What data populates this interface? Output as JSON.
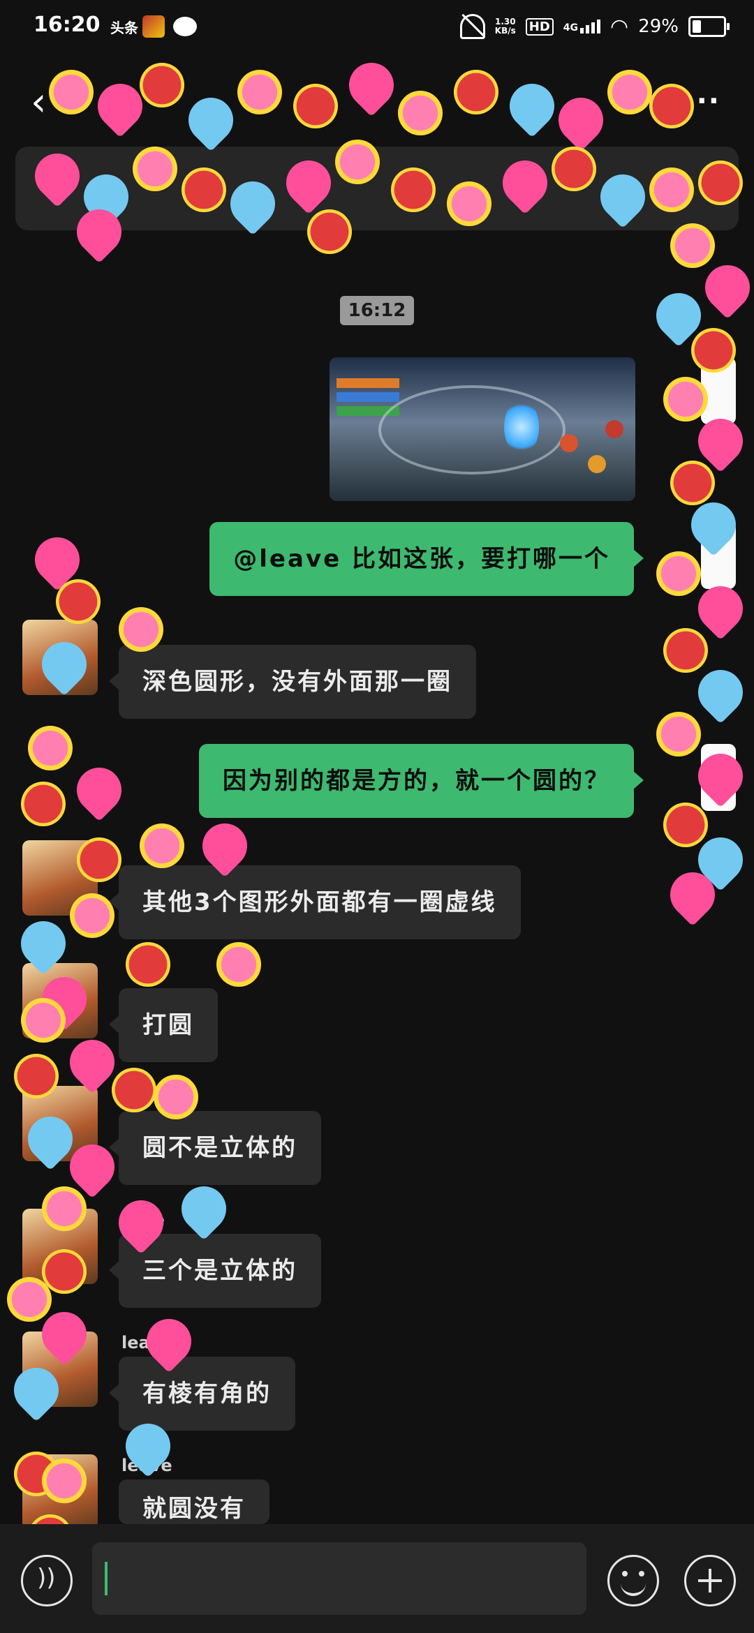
{
  "status_bar": {
    "time": "16:20",
    "app_badge": "头条",
    "net_speed_value": "1.30",
    "net_speed_unit": "KB/s",
    "hd": "HD",
    "network": "4G",
    "battery": "29%"
  },
  "nav": {
    "back_icon": "chevron-left-icon",
    "more_icon": "more-horizontal-icon"
  },
  "timestamp": "16:12",
  "messages": [
    {
      "type": "outgoing",
      "text": "@leave 比如这张，要打哪一个"
    },
    {
      "type": "incoming",
      "text": "深色圆形，没有外面那一圈"
    },
    {
      "type": "outgoing",
      "text": "因为别的都是方的，就一个圆的？"
    },
    {
      "type": "incoming",
      "text": "其他3个图形外面都有一圈虚线"
    },
    {
      "type": "incoming",
      "text": "打圆"
    },
    {
      "type": "incoming",
      "text": "圆不是立体的"
    },
    {
      "type": "incoming",
      "sender": "ve",
      "text": "三个是立体的"
    },
    {
      "type": "incoming",
      "sender": "lea",
      "text": "有棱有角的"
    },
    {
      "type": "incoming",
      "sender": "leave",
      "text": "就圆没有"
    }
  ],
  "input": {
    "voice_icon": "voice-icon",
    "emoji_icon": "emoji-icon",
    "plus_icon": "plus-icon"
  },
  "overlay": {
    "sticker_theme": "sugar-with-love"
  }
}
